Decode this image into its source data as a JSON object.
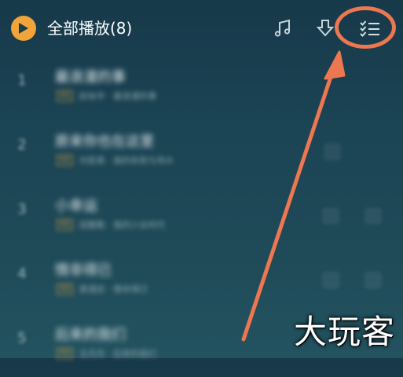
{
  "header": {
    "play_icon": "play-icon",
    "title": "全部播放(8)",
    "icons": [
      "music-note-icon",
      "download-icon",
      "list-manage-icon"
    ]
  },
  "list": {
    "items": [
      {
        "index": "1",
        "title": "最浪漫的事",
        "subtitle": "赵咏华 · 最浪漫的事",
        "tag": "SQ"
      },
      {
        "index": "2",
        "title": "原来你也在这里",
        "subtitle": "刘若英 · 我的失败与伟大",
        "tag": "SQ"
      },
      {
        "index": "3",
        "title": "小幸运",
        "subtitle": "田馥甄 · 我的少女时代",
        "tag": "SQ"
      },
      {
        "index": "4",
        "title": "情非得已",
        "subtitle": "庾澄庆 · 情非得已",
        "tag": "SQ"
      },
      {
        "index": "5",
        "title": "后来的我们",
        "subtitle": "五月天 · 后来的我们",
        "tag": "SQ"
      }
    ]
  },
  "annotation": {
    "color": "#ec7750"
  },
  "watermark": {
    "text": "大玩客"
  },
  "colors": {
    "accent_play": "#f0a43a",
    "background_top": "#17394a",
    "background_bottom": "#235360"
  }
}
